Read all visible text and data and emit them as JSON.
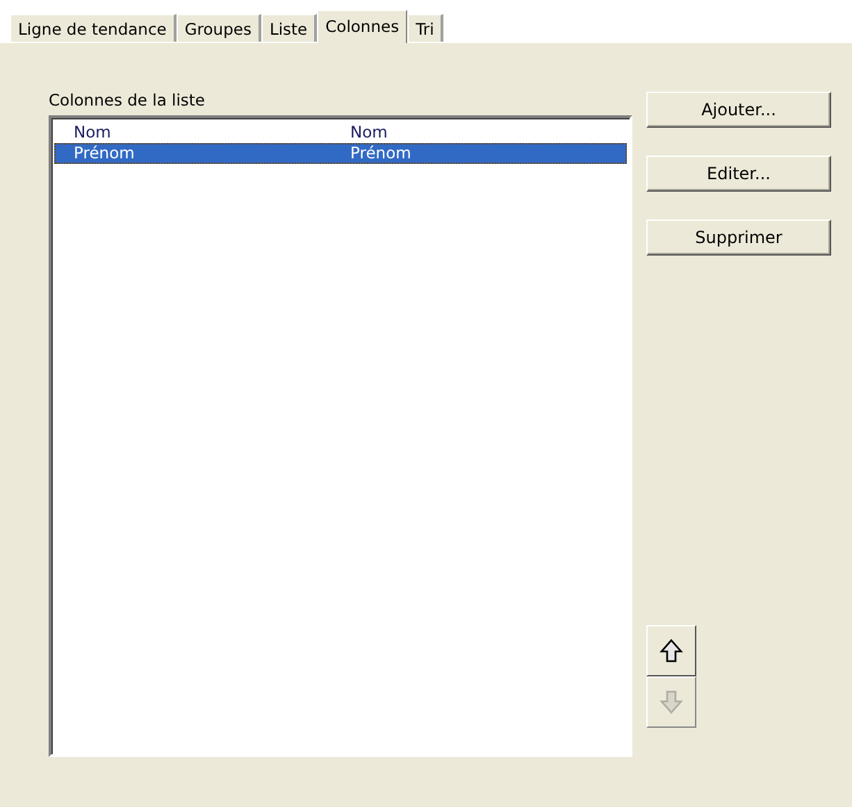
{
  "tabs": [
    {
      "label": "Ligne de tendance",
      "selected": false
    },
    {
      "label": "Groupes",
      "selected": false
    },
    {
      "label": "Liste",
      "selected": false
    },
    {
      "label": "Colonnes",
      "selected": true
    },
    {
      "label": "Tri",
      "selected": false
    }
  ],
  "list": {
    "label": "Colonnes de la liste",
    "rows": [
      {
        "cells": [
          "Nom",
          "Nom"
        ],
        "selected": false
      },
      {
        "cells": [
          "Prénom",
          "Prénom"
        ],
        "selected": true
      }
    ]
  },
  "buttons": [
    "Ajouter...",
    "Editer...",
    "Supprimer"
  ],
  "move_buttons": [
    {
      "kind": "up",
      "disabled": false
    },
    {
      "kind": "down",
      "disabled": true
    }
  ]
}
